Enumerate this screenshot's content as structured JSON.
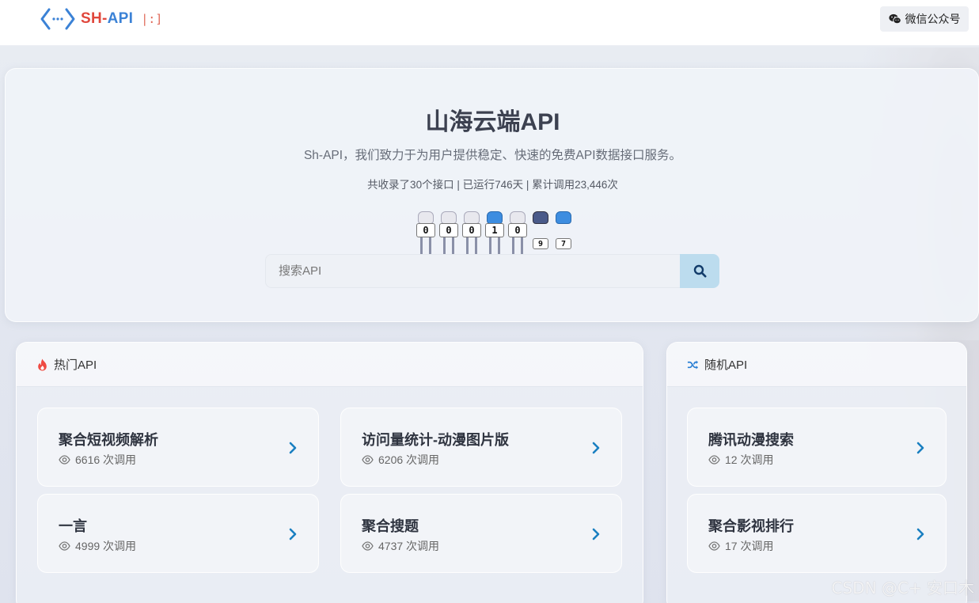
{
  "header": {
    "logo_sh": "SH",
    "logo_dash": "-",
    "logo_api": "API",
    "logo_cursor": "|:]",
    "wechat_label": "微信公众号"
  },
  "hero": {
    "title": "山海云端API",
    "subtitle": "Sh-API，我们致力于为用户提供稳定、快速的免费API数据接口服务。",
    "stats": "共收录了30个接口 | 已运行746天 | 累计调用23,446次",
    "counter_digits": [
      "0",
      "0",
      "0",
      "1",
      "0",
      "9",
      "7"
    ],
    "search_placeholder": "搜索API"
  },
  "hot": {
    "title": "热门API",
    "items": [
      {
        "name": "聚合短视频解析",
        "calls": "6616 次调用"
      },
      {
        "name": "访问量统计-动漫图片版",
        "calls": "6206 次调用"
      },
      {
        "name": "一言",
        "calls": "4999 次调用"
      },
      {
        "name": "聚合搜题",
        "calls": "4737 次调用"
      }
    ]
  },
  "random": {
    "title": "随机API",
    "items": [
      {
        "name": "腾讯动漫搜索",
        "calls": "12 次调用"
      },
      {
        "name": "聚合影视排行",
        "calls": "17 次调用"
      }
    ]
  },
  "watermark": "CSDN @C+ 安口木",
  "colors": {
    "accent": "#1a7fc1",
    "hot_icon": "#ef4b43",
    "random_icon": "#2a7fd4",
    "search_button": "#bcdcee",
    "logo_red": "#e0473c",
    "logo_blue": "#3b82d6"
  }
}
